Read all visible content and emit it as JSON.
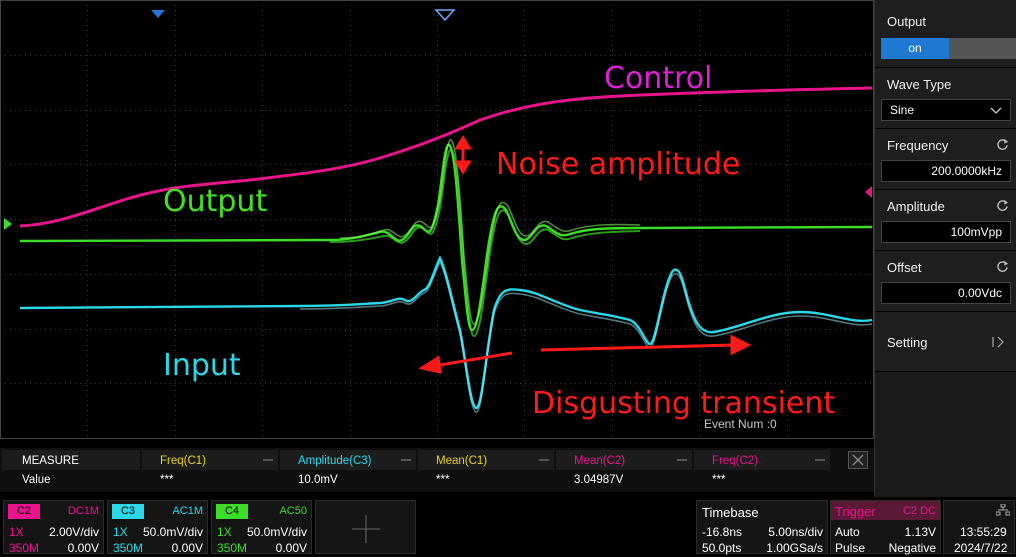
{
  "annotations": {
    "control": "Control",
    "output": "Output",
    "input": "Input",
    "noise": "Noise amplitude",
    "transient": "Disgusting transient"
  },
  "event_num": "Event Num :0",
  "panel": {
    "output_label": "Output",
    "output_state": "on",
    "wave_type_label": "Wave Type",
    "wave_type_value": "Sine",
    "frequency_label": "Frequency",
    "frequency_value": "200.0000kHz",
    "amplitude_label": "Amplitude",
    "amplitude_value": "100mVpp",
    "offset_label": "Offset",
    "offset_value": "0.00Vdc",
    "setting_label": "Setting"
  },
  "measure": {
    "title": "MEASURE",
    "row_label": "Value",
    "columns": [
      {
        "name": "Freq(C1)",
        "value": "***",
        "color": "#e6d21e"
      },
      {
        "name": "Amplitude(C3)",
        "value": "10.0mV",
        "color": "#2ad8e8"
      },
      {
        "name": "Mean(C1)",
        "value": "***",
        "color": "#e6d21e"
      },
      {
        "name": "Mean(C2)",
        "value": "3.04987V",
        "color": "#e8148c"
      },
      {
        "name": "Freq(C2)",
        "value": "***",
        "color": "#e8148c"
      }
    ]
  },
  "channels": [
    {
      "tag": "C2",
      "coupling": "DC1M",
      "probe": "1X",
      "scale": "2.00V/div",
      "bw": "350M",
      "offset": "0.00V",
      "color": "#e8148c"
    },
    {
      "tag": "C3",
      "coupling": "AC1M",
      "probe": "1X",
      "scale": "50.0mV/div",
      "bw": "350M",
      "offset": "0.00V",
      "color": "#2ad8e8"
    },
    {
      "tag": "C4",
      "coupling": "AC50",
      "probe": "1X",
      "scale": "50.0mV/div",
      "bw": "350M",
      "offset": "0.00V",
      "color": "#3cdc28"
    }
  ],
  "timebase": {
    "label": "Timebase",
    "delay": "-16.8ns",
    "scale": "5.00ns/div",
    "points": "50.0pts",
    "rate": "1.00GSa/s"
  },
  "trigger": {
    "label": "Trigger",
    "source": "C2 DC",
    "mode": "Auto",
    "level": "1.13V",
    "type": "Pulse",
    "polarity": "Negative"
  },
  "clock": {
    "time": "13:55:29",
    "date": "2024/7/22"
  },
  "colors": {
    "ch2": "#e8148c",
    "ch3": "#2ad8e8",
    "ch4": "#3cdc28",
    "annotation_red": "#ff1a1a",
    "annotation_magenta": "#e020d8",
    "annotation_green": "#44e020",
    "annotation_cyan": "#2ad8e8",
    "button_on": "#1f78d1"
  }
}
